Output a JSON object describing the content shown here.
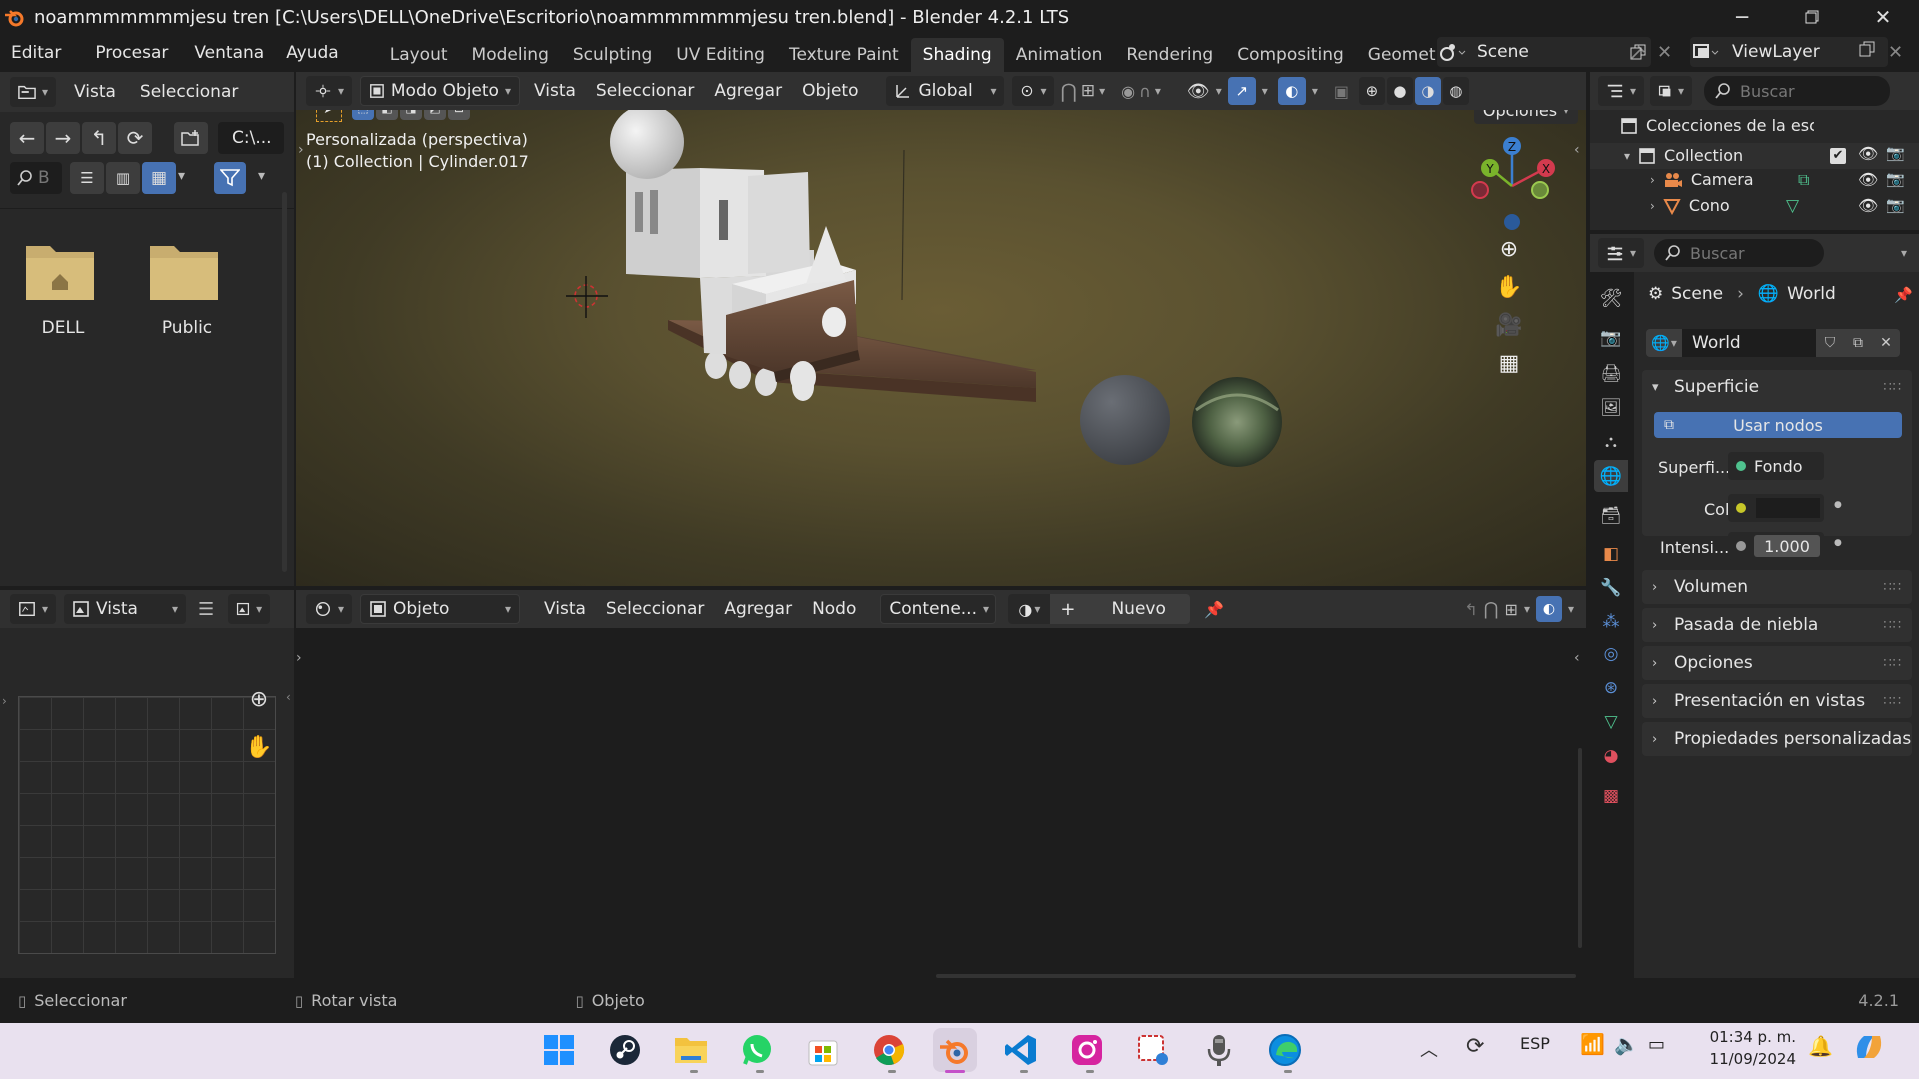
{
  "window": {
    "title": "noammmmmmmjesu tren [C:\\Users\\DELL\\OneDrive\\Escritorio\\noammmmmmmjesu tren.blend] - Blender 4.2.1 LTS"
  },
  "menus": [
    "Editar",
    "Procesar",
    "Ventana",
    "Ayuda"
  ],
  "workspaces": [
    "Layout",
    "Modeling",
    "Sculpting",
    "UV Editing",
    "Texture Paint",
    "Shading",
    "Animation",
    "Rendering",
    "Compositing",
    "Geometry Noc"
  ],
  "scene": {
    "name": "Scene",
    "view_layer": "ViewLayer"
  },
  "file_browser": {
    "menu_vista": "Vista",
    "menu_seleccionar": "Seleccionar",
    "path": "C:\\...",
    "search_placeholder": "B",
    "items": [
      {
        "name": "DELL",
        "icon": "home-folder-icon"
      },
      {
        "name": "Public",
        "icon": "folder-icon"
      }
    ]
  },
  "viewport": {
    "mode": "Modo Objeto",
    "menus": [
      "Vista",
      "Seleccionar",
      "Agregar",
      "Objeto"
    ],
    "orientation": "Global",
    "options": "Opciones",
    "overlay_line1": "Personalizada (perspectiva)",
    "overlay_line2": "(1) Collection | Cylinder.017",
    "gizmo": {
      "x": "X",
      "y": "Y",
      "z": "Z"
    }
  },
  "image_editor": {
    "view": "Vista"
  },
  "node_editor": {
    "type": "Objeto",
    "menus": [
      "Vista",
      "Seleccionar",
      "Agregar",
      "Nodo"
    ],
    "context": "Contene...",
    "new_label": "Nuevo"
  },
  "outliner": {
    "search_placeholder": "Buscar",
    "root": "Colecciones de la esc",
    "items": [
      {
        "name": "Collection",
        "icon": "collection-icon"
      },
      {
        "name": "Camera",
        "icon": "camera-icon"
      },
      {
        "name": "Cono",
        "icon": "cone-mesh-icon"
      }
    ]
  },
  "properties": {
    "search_placeholder": "Buscar",
    "breadcrumb": [
      "Scene",
      "World"
    ],
    "world_name": "World",
    "surface_section": "Superficie",
    "use_nodes": "Usar nodos",
    "surface_label": "Superfi...",
    "surface_value": "Fondo",
    "color_label": "Color",
    "strength_label": "Intensi...",
    "strength_value": "1.000",
    "sections": [
      "Volumen",
      "Pasada de niebla",
      "Opciones",
      "Presentación en vistas",
      "Propiedades personalizadas"
    ]
  },
  "statusbar": {
    "select": "Seleccionar",
    "rotate": "Rotar vista",
    "object": "Objeto",
    "version": "4.2.1"
  },
  "taskbar": {
    "language": "ESP",
    "time": "01:34 p. m.",
    "date": "11/09/2024"
  }
}
